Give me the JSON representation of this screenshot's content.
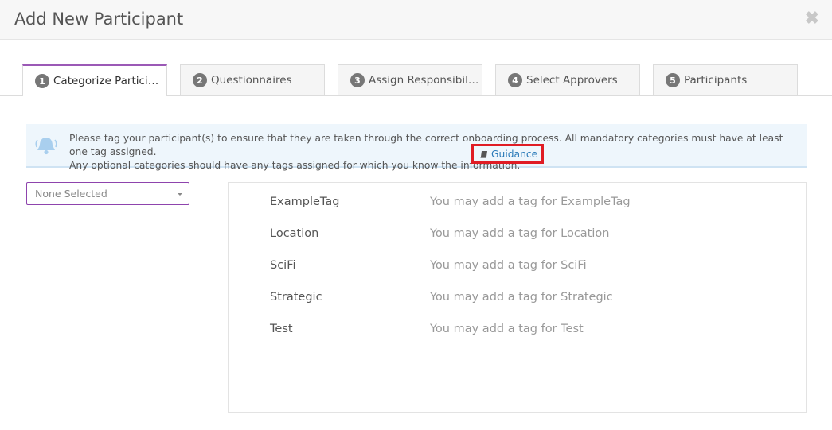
{
  "modal": {
    "title": "Add New Participant",
    "close_symbol": "✖"
  },
  "tabs": [
    {
      "number": "1",
      "label": "Categorize Particip..."
    },
    {
      "number": "2",
      "label": "Questionnaires"
    },
    {
      "number": "3",
      "label": "Assign Responsibili..."
    },
    {
      "number": "4",
      "label": "Select Approvers"
    },
    {
      "number": "5",
      "label": "Participants"
    }
  ],
  "alert": {
    "line1": "Please tag your participant(s) to ensure that they are taken through the correct onboarding process. All mandatory categories must have at least one tag assigned.",
    "line2": "Any optional categories should have any tags assigned for which you know the information.",
    "guidance_label": "Guidance",
    "icon": "bell-icon"
  },
  "filter": {
    "selected": "None Selected"
  },
  "categories": [
    {
      "name": "ExampleTag",
      "hint": "You may add a tag for ExampleTag"
    },
    {
      "name": "Location",
      "hint": "You may add a tag for Location"
    },
    {
      "name": "SciFi",
      "hint": "You may add a tag for SciFi"
    },
    {
      "name": "Strategic",
      "hint": "You may add a tag for Strategic"
    },
    {
      "name": "Test",
      "hint": "You may add a tag for Test"
    }
  ],
  "colors": {
    "accent": "#9b59b6",
    "alert_bg": "#eef6fc",
    "highlight": "#e01c24",
    "link": "#2a7ab8"
  }
}
